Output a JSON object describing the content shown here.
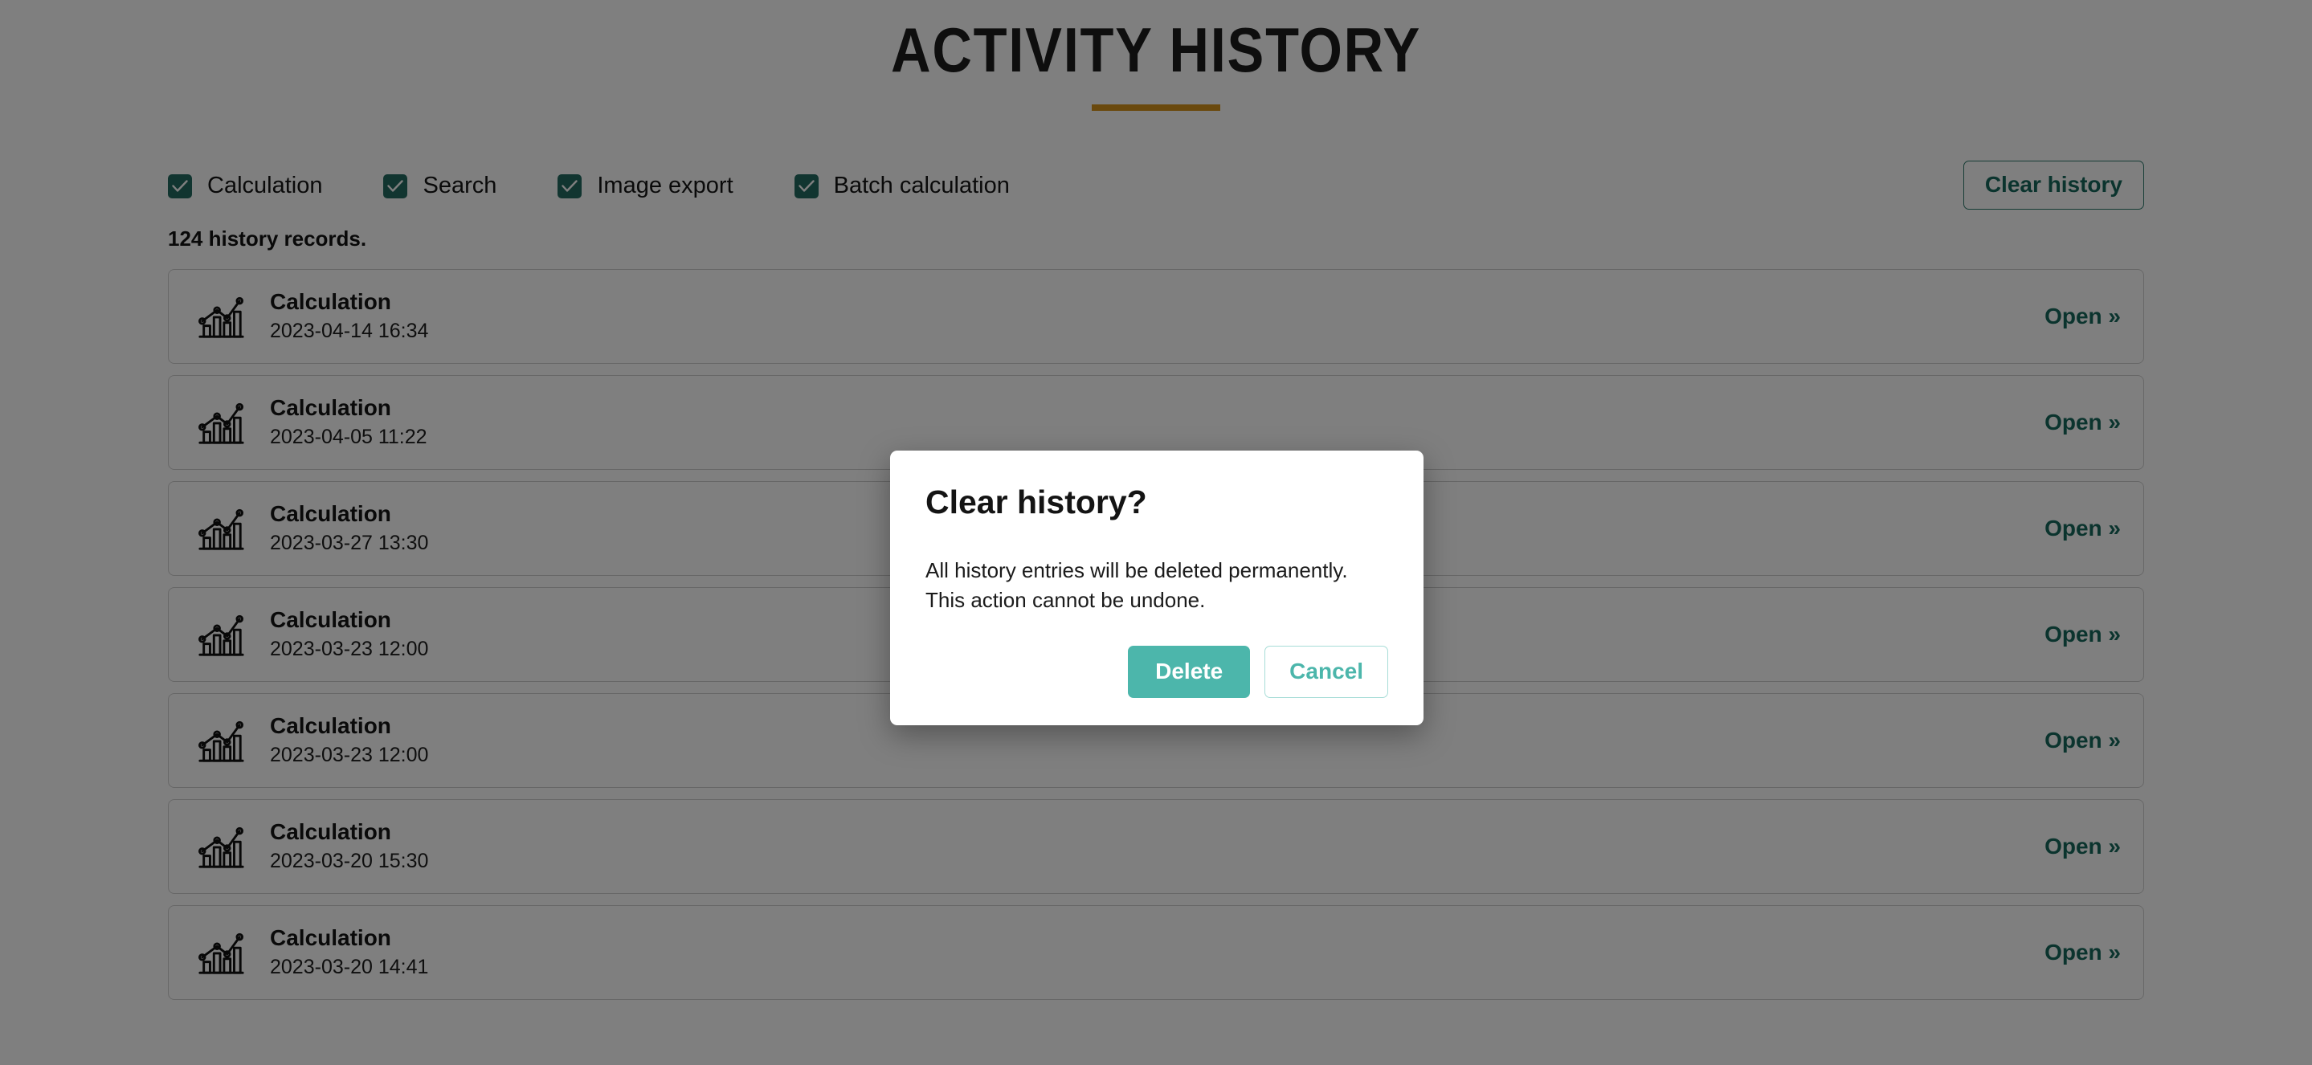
{
  "header": {
    "title": "Activity history",
    "accent_color": "#d4921b"
  },
  "filters": {
    "items": [
      {
        "label": "Calculation",
        "checked": true
      },
      {
        "label": "Search",
        "checked": true
      },
      {
        "label": "Image export",
        "checked": true
      },
      {
        "label": "Batch calculation",
        "checked": true
      }
    ],
    "checkbox_color": "#236b60"
  },
  "toolbar": {
    "clear_history_label": "Clear history",
    "clear_history_color": "#17685c"
  },
  "list": {
    "records_count_text": "124 history records.",
    "open_label": "Open »",
    "icon_name": "bar-chart-trend-icon",
    "rows": [
      {
        "title": "Calculation",
        "date": "2023-04-14 16:34"
      },
      {
        "title": "Calculation",
        "date": "2023-04-05 11:22"
      },
      {
        "title": "Calculation",
        "date": "2023-03-27 13:30"
      },
      {
        "title": "Calculation",
        "date": "2023-03-23 12:00"
      },
      {
        "title": "Calculation",
        "date": "2023-03-23 12:00"
      },
      {
        "title": "Calculation",
        "date": "2023-03-20 15:30"
      },
      {
        "title": "Calculation",
        "date": "2023-03-20 14:41"
      }
    ]
  },
  "dialog": {
    "title": "Clear history?",
    "body_line1": "All history entries will be deleted permanently.",
    "body_line2": "This action cannot be undone.",
    "delete_label": "Delete",
    "cancel_label": "Cancel",
    "delete_color": "#4cb6ab",
    "cancel_border_color": "#a7ddd7"
  }
}
